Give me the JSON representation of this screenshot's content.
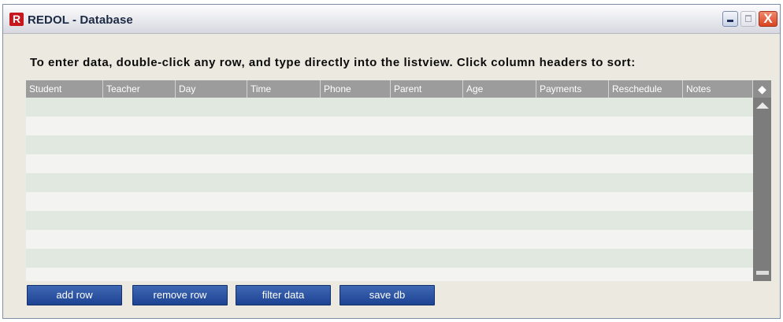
{
  "window": {
    "app_icon_letter": "R",
    "title": "REDOL - Database",
    "controls": {
      "minimize": "minimize",
      "maximize": "maximize",
      "close": "X"
    }
  },
  "instructions": "To enter data, double-click any row, and type directly into the listview. Click column headers to sort:",
  "listview": {
    "columns": [
      {
        "label": "Student"
      },
      {
        "label": "Teacher"
      },
      {
        "label": "Day"
      },
      {
        "label": "Time"
      },
      {
        "label": "Phone"
      },
      {
        "label": "Parent"
      },
      {
        "label": "Age"
      },
      {
        "label": "Payments"
      },
      {
        "label": "Reschedule"
      },
      {
        "label": "Notes"
      }
    ],
    "corner_icon": "diamond-icon",
    "rows": [
      {},
      {},
      {},
      {},
      {},
      {},
      {},
      {},
      {},
      {}
    ],
    "colors": {
      "header": "#9c9c9c",
      "row_even": "#e0e8df",
      "row_odd": "#f3f4f1",
      "scrollbar": "#7c7c7c"
    }
  },
  "buttons": {
    "add_row": "add row",
    "remove_row": "remove row",
    "filter_data": "filter data",
    "save_db": "save db"
  },
  "colors": {
    "button_blue": "#2a53a3",
    "close_red": "#d9431f",
    "app_icon_red": "#c8161d"
  }
}
